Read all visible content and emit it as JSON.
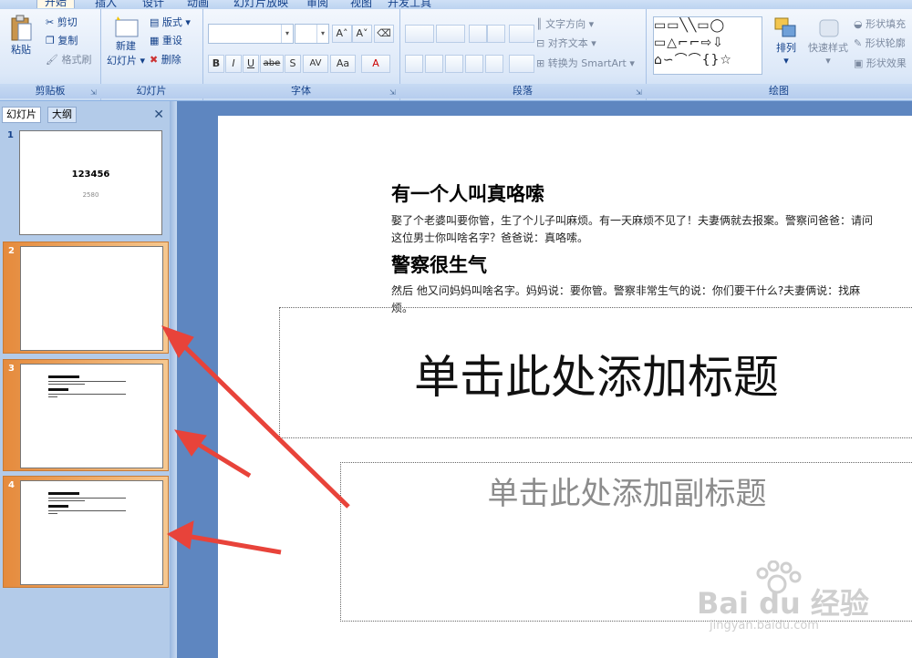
{
  "ribbon": {
    "tabs": [
      "开始",
      "插入",
      "设计",
      "动画",
      "幻灯片放映",
      "审阅",
      "视图",
      "开发工具"
    ],
    "clipboard": {
      "label": "剪贴板",
      "paste": "粘贴",
      "cut": "剪切",
      "copy": "复制",
      "format_painter": "格式刷"
    },
    "slides": {
      "label": "幻灯片",
      "new_slide_line1": "新建",
      "new_slide_line2": "幻灯片",
      "layout": "版式",
      "reset": "重设",
      "delete": "删除"
    },
    "font": {
      "label": "字体",
      "font_name": "",
      "font_size": "",
      "bold": "B",
      "italic": "I",
      "underline": "U",
      "strike": "abe",
      "shadow": "S",
      "spacing": "AV",
      "case": "Aa",
      "color": "A"
    },
    "paragraph": {
      "label": "段落",
      "text_direction": "文字方向",
      "align_text": "对齐文本",
      "smartart": "转换为 SmartArt"
    },
    "drawing": {
      "label": "绘图",
      "arrange": "排列",
      "quick_styles": "快速样式",
      "shape_fill": "形状填充",
      "shape_outline": "形状轮廓",
      "shape_effects": "形状效果"
    }
  },
  "panel": {
    "tab_slides": "幻灯片",
    "tab_outline": "大纲",
    "close": "✕",
    "slides": [
      {
        "num": "1",
        "title": "123456",
        "subtitle": "2580"
      },
      {
        "num": "2"
      },
      {
        "num": "3"
      },
      {
        "num": "4"
      }
    ]
  },
  "slide": {
    "heading1": "有一个人叫真咯嗦",
    "para1": "娶了个老婆叫要你管，生了个儿子叫麻烦。有一天麻烦不见了！夫妻俩就去报案。警察问爸爸：请问这位男士你叫啥名字？爸爸说：真咯嗦。",
    "heading2": "警察很生气",
    "para2": "然后 他又问妈妈叫啥名字。妈妈说：要你管。警察非常生气的说：你们要干什么?夫妻俩说：找麻烦。",
    "title_placeholder": "单击此处添加标题",
    "subtitle_placeholder": "单击此处添加副标题"
  },
  "watermark": {
    "brand": "Bai du 经验",
    "url": "jingyan.baidu.com"
  },
  "colors": {
    "arrow": "#e8433a",
    "selected_thumb": "#e58a3c",
    "ribbon_text": "#15428b"
  }
}
